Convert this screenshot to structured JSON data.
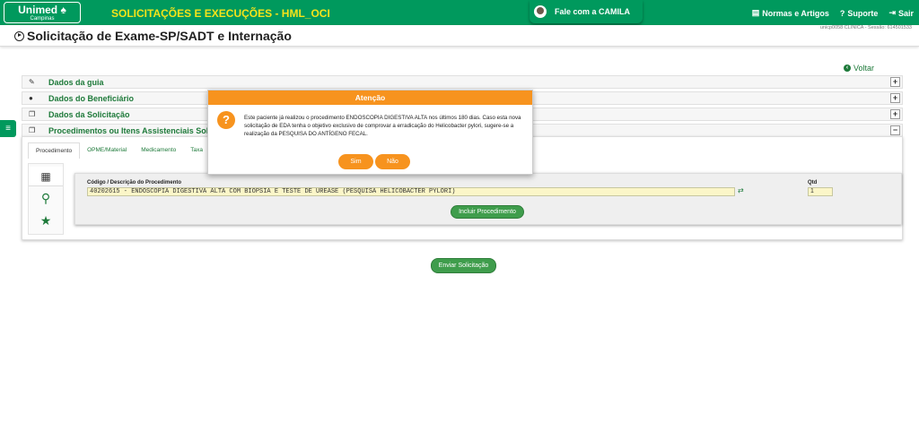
{
  "brand": {
    "name": "Unimed",
    "city": "Campinas"
  },
  "header": {
    "app_title": "SOLICITAÇÕES E EXECUÇÕES - HML_OCI",
    "chat_label": "Fale com a CAMILA",
    "links": [
      {
        "icon": "book-icon",
        "label": "Normas e Artigos"
      },
      {
        "icon": "help-icon",
        "label": "Suporte"
      },
      {
        "icon": "logout-icon",
        "label": "Sair"
      }
    ]
  },
  "page": {
    "title": "Solicitação de Exame-SP/SADT e Internação",
    "session_info": "unicp0058 CLINICA - Sessão: 614501533",
    "back_label": "Voltar"
  },
  "sections": [
    {
      "icon": "edit-icon",
      "label": "Dados da guia",
      "toggle": "+"
    },
    {
      "icon": "user-icon",
      "label": "Dados do Beneficiário",
      "toggle": "+"
    },
    {
      "icon": "copy-icon",
      "label": "Dados da Solicitação",
      "toggle": "+"
    },
    {
      "icon": "copy-icon",
      "label": "Procedimentos ou Itens Assistenciais Solicitados",
      "toggle": "−"
    }
  ],
  "tabs": [
    "Procedimento",
    "OPME/Material",
    "Medicamento",
    "Taxa"
  ],
  "procedure_form": {
    "code_label": "Código / Descrição do Procedimento",
    "code_value": "40202615 - ENDOSCOPIA DIGESTIVA ALTA COM BIOPSIA E TESTE DE UREASE (PESQUISA HELICOBACTER PYLORI)",
    "qty_label": "Qtd",
    "qty_value": "1",
    "include_button": "Incluir Procedimento"
  },
  "submit_button": "Enviar Solicitação",
  "modal": {
    "title": "Atenção",
    "message": "Este paciente já realizou o procedimento ENDOSCOPIA DIGESTIVA ALTA nos últimos 180 dias. Caso esta nova solicitação de EDA tenha o objetivo exclusivo de comprovar a erradicação do Helicobacter pylori, sugere-se a realização da PESQUISA DO ANTÍGENO FECAL.",
    "yes_label": "Sim",
    "no_label": "Não"
  },
  "colors": {
    "primary": "#00995d",
    "accent": "#f7931e",
    "title_yellow": "#f5e31a",
    "link_green": "#1e7a3a"
  }
}
